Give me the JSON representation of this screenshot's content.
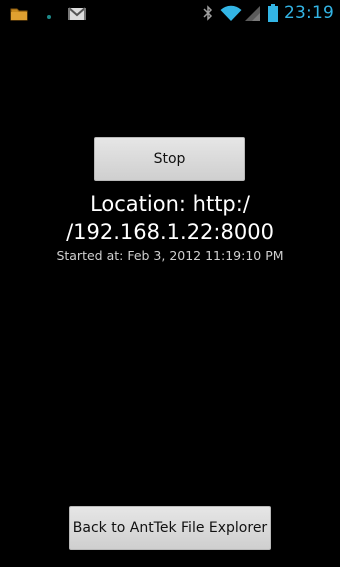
{
  "status_bar": {
    "time": "23:19",
    "colors": {
      "clock": "#33b5e5",
      "icons": "#33b5e5"
    },
    "icons": [
      "folder-icon",
      "dot-icon",
      "gmail-icon",
      "bluetooth-icon",
      "wifi-icon",
      "signal-icon",
      "battery-icon"
    ]
  },
  "main": {
    "stop_label": "Stop",
    "location_line1": "Location: http:/",
    "location_line2": "/192.168.1.22:8000",
    "started_text": "Started at: Feb 3, 2012 11:19:10 PM",
    "back_label": "Back to AntTek File Explorer"
  }
}
